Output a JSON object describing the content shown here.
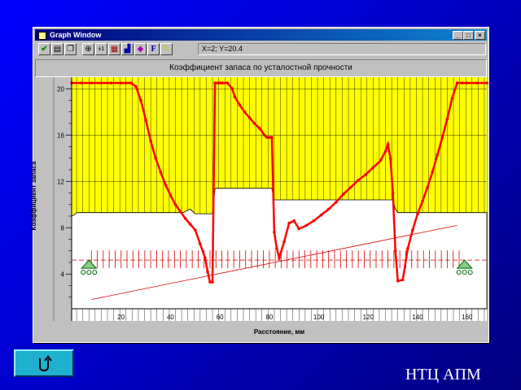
{
  "window": {
    "title": "Graph Window",
    "buttons": [
      "_",
      "□",
      "×"
    ],
    "coord_readout": "X=2; Y=20.4"
  },
  "toolbar": {
    "tools": [
      "check-icon",
      "print-icon",
      "copy-icon",
      "zoom-in-icon",
      "range-icon",
      "grid-icon",
      "bar-chart-icon",
      "color-icon",
      "font-icon",
      "help-icon"
    ],
    "font_glyph": "F",
    "range_glyph": "±1"
  },
  "chart_data": {
    "type": "line",
    "title": "Коэффициент запаса по усталостной прочности",
    "xlabel": "Расстояние, мм",
    "ylabel": "Коэффициент запаса",
    "xlim": [
      0,
      168
    ],
    "ylim": [
      1,
      21
    ],
    "x_ticks": [
      20,
      40,
      60,
      80,
      100,
      120,
      140,
      160
    ],
    "y_ticks": [
      4,
      8,
      12,
      16,
      20
    ],
    "background": "#ffff00",
    "line_color": "#ff0000",
    "series": [
      {
        "values_x": [
          0,
          4,
          8,
          12,
          16,
          20,
          22,
          24,
          26,
          28,
          30,
          32,
          34,
          36,
          38,
          40,
          42,
          44,
          46,
          48,
          50,
          52,
          54,
          55,
          56,
          57,
          58,
          59,
          60,
          61,
          63,
          65,
          66,
          68,
          70,
          72,
          74,
          76,
          78,
          79,
          80,
          81,
          82,
          83,
          84,
          86,
          88,
          90,
          92,
          95,
          98,
          101,
          104,
          107,
          110,
          113,
          116,
          119,
          122,
          125,
          127,
          128,
          129,
          130,
          131,
          132,
          134,
          136,
          138,
          140,
          142,
          144,
          146,
          148,
          150,
          152,
          154,
          156,
          158,
          160,
          164,
          168
        ],
        "values_y": [
          20.5,
          20.5,
          20.5,
          20.5,
          20.5,
          20.5,
          20.5,
          20.5,
          20.2,
          19,
          17.3,
          15.5,
          14,
          12.8,
          11.7,
          10.8,
          10,
          9.4,
          8.8,
          8.3,
          7.8,
          6.6,
          5.4,
          4.2,
          3.3,
          3.3,
          20.5,
          20.5,
          20.5,
          20.5,
          20.5,
          20,
          19.3,
          18.6,
          18,
          17.5,
          17,
          16.6,
          16,
          15.8,
          15.8,
          15.8,
          7.6,
          6.2,
          5.4,
          6.8,
          8.4,
          8.6,
          7.9,
          8.2,
          8.6,
          9.1,
          9.6,
          10.2,
          10.9,
          11.5,
          12.1,
          12.6,
          13.2,
          13.8,
          14.6,
          15.2,
          14,
          11,
          6,
          3.4,
          3.5,
          6.2,
          7.8,
          9.2,
          10.3,
          11.5,
          12.8,
          14.3,
          15.8,
          17.4,
          19.2,
          20.5,
          20.5,
          20.5,
          20.5,
          20.5
        ]
      }
    ],
    "shaft_profile_x": [
      0,
      1,
      2,
      5,
      45,
      48,
      50,
      54,
      56,
      57,
      58,
      60,
      64,
      70,
      78,
      80,
      81,
      82,
      84,
      98,
      100,
      102,
      104,
      106,
      110,
      126,
      128,
      130,
      131,
      132,
      134,
      168
    ],
    "shaft_profile_y": [
      9,
      9.1,
      9.3,
      9.3,
      9.3,
      9.6,
      9.2,
      9.2,
      9.2,
      9.2,
      11.4,
      11.4,
      11.4,
      11.4,
      11.4,
      11.4,
      11.4,
      10.4,
      10.4,
      10.4,
      10.4,
      10.4,
      10.4,
      10.4,
      10.4,
      10.4,
      10.4,
      10.4,
      9.6,
      9.3,
      9.3,
      9.3
    ],
    "load_line": {
      "x": [
        8,
        156
      ],
      "y": [
        1.8,
        8.2
      ]
    },
    "supports_x": [
      7,
      159
    ],
    "arrow_level_y": 5.2
  },
  "footer": {
    "brand": "НТЦ АПМ"
  },
  "nav": {
    "back_icon": "u-turn-icon"
  }
}
